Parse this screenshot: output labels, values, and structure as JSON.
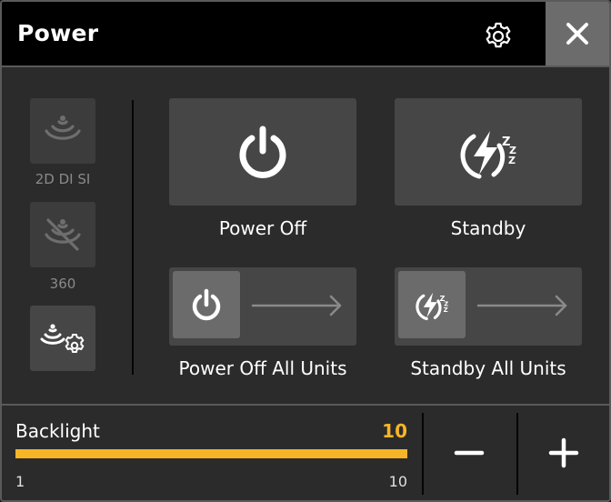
{
  "header": {
    "title": "Power",
    "settings_icon": "gear-icon",
    "close_icon": "close-icon"
  },
  "sidebar": {
    "items": [
      {
        "label": "2D DI SI",
        "icon": "sonar-waves-icon",
        "enabled": false
      },
      {
        "label": "360",
        "icon": "sonar-360-icon",
        "enabled": false
      },
      {
        "label": "",
        "icon": "sonar-settings-icon",
        "enabled": true
      }
    ]
  },
  "actions": {
    "power_off": {
      "label": "Power Off",
      "icon": "power-icon"
    },
    "standby": {
      "label": "Standby",
      "icon": "standby-bolt-icon"
    },
    "power_off_all": {
      "label": "Power Off All Units",
      "icon": "power-icon",
      "arrow_icon": "arrow-right-icon"
    },
    "standby_all": {
      "label": "Standby All Units",
      "icon": "standby-bolt-icon",
      "arrow_icon": "arrow-right-icon"
    }
  },
  "backlight": {
    "label": "Backlight",
    "value": "10",
    "min_label": "1",
    "max_label": "10",
    "level_fraction": 1.0,
    "decrease_icon": "minus-icon",
    "increase_icon": "plus-icon"
  },
  "colors": {
    "accent": "#f6b526",
    "header_bg": "#000000",
    "tile_bg": "#464646",
    "panel_bg": "#2b2b2b",
    "close_bg": "#6c6c6c"
  }
}
